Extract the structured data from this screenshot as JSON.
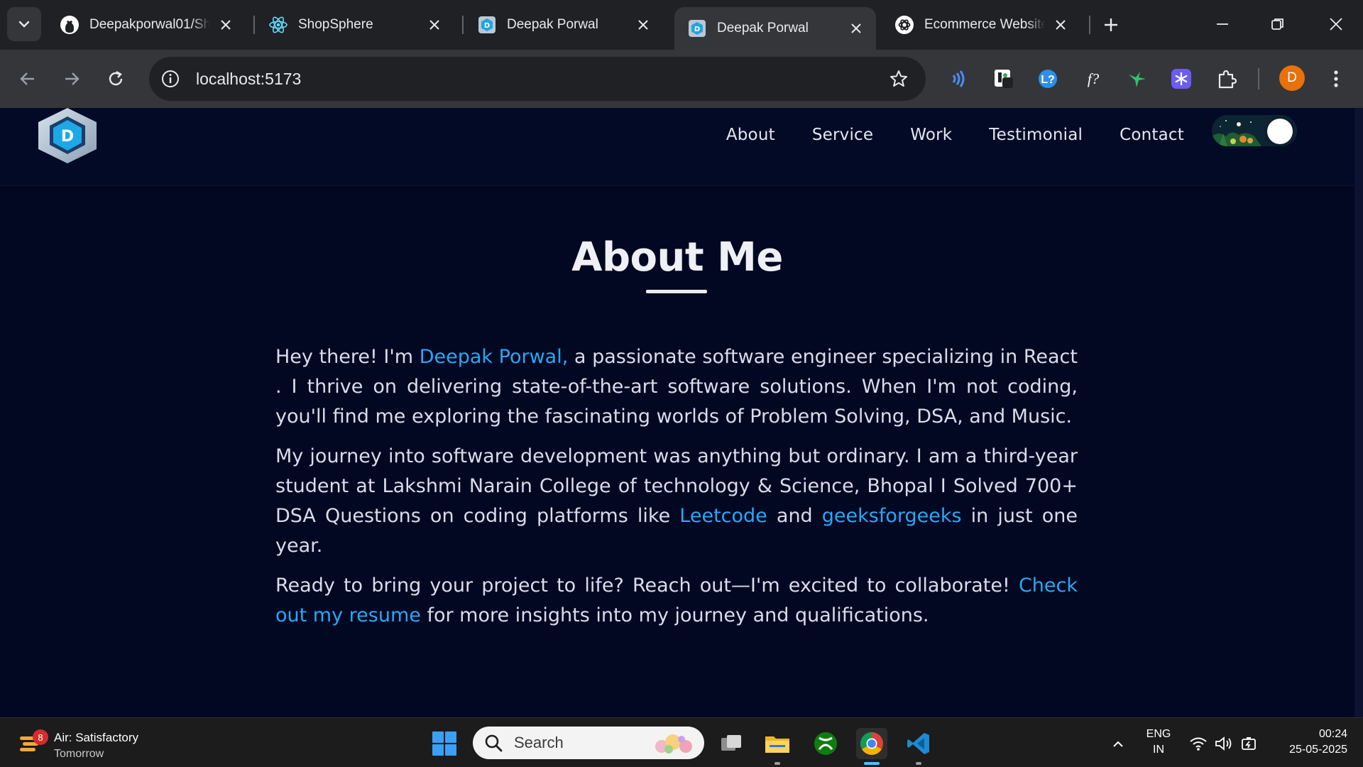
{
  "browser": {
    "tabs": [
      {
        "title": "Deepakporwal01/Sh",
        "icon": "github-icon"
      },
      {
        "title": "ShopSphere",
        "icon": "react-icon"
      },
      {
        "title": "Deepak Porwal",
        "icon": "site-logo-icon"
      },
      {
        "title": "Deepak Porwal",
        "icon": "site-logo-icon",
        "active": true
      },
      {
        "title": "Ecommerce Website",
        "icon": "chatgpt-icon"
      }
    ],
    "url": "localhost:5173",
    "profile_initial": "D",
    "extensions": [
      "wave-extension-icon",
      "dark-reader-icon",
      "lingq-icon",
      "formula-icon",
      "hummingbird-icon",
      "snowflake-extension-icon",
      "puzzle-icon"
    ]
  },
  "site": {
    "nav": {
      "links": [
        "About",
        "Service",
        "Work",
        "Testimonial",
        "Contact"
      ]
    },
    "about": {
      "title": "About Me",
      "p1_a": "Hey there! I'm ",
      "p1_name": "Deepak Porwal,",
      "p1_b": " a passionate software engineer specializing in React . I thrive on delivering state-of-the-art software solutions. When I'm not coding, you'll find me exploring the fascinating worlds of Problem Solving, DSA, and Music.",
      "p2_a": "My journey into software development was anything but ordinary. I am a third-year student at Lakshmi Narain College of technology & Science, Bhopal I Solved 700+ DSA Questions on coding platforms like ",
      "p2_link1": "Leetcode",
      "p2_b": " and ",
      "p2_link2": "geeksforgeeks",
      "p2_c": " in just one year.",
      "p3_a": "Ready to bring your project to life? Reach out—I'm excited to collaborate! ",
      "p3_link": "Check out my resume",
      "p3_b": " for more insights into my journey and qualifications."
    },
    "colors": {
      "background": "#020822",
      "accent": "#29a8f5"
    }
  },
  "taskbar": {
    "weather": {
      "badge": "8",
      "line1": "Air: Satisfactory",
      "line2": "Tomorrow"
    },
    "search_placeholder": "Search",
    "lang": {
      "line1": "ENG",
      "line2": "IN"
    },
    "clock": {
      "time": "00:24",
      "date": "25-05-2025"
    }
  }
}
